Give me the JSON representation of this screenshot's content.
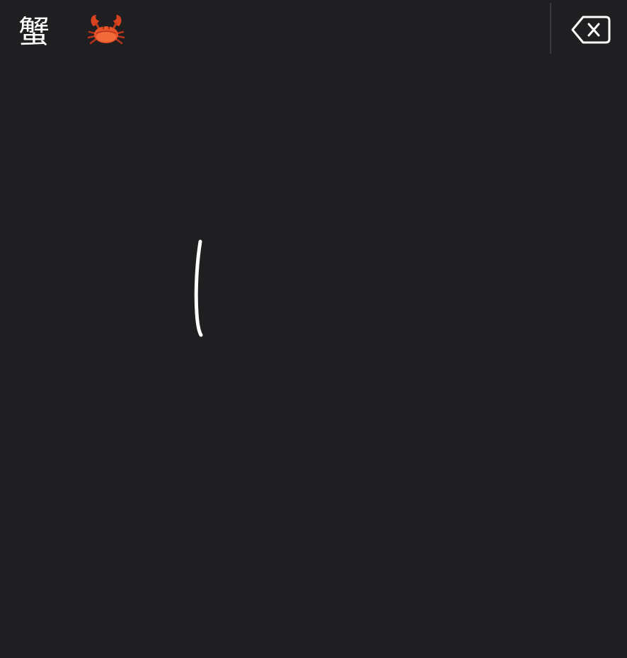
{
  "candidates": [
    {
      "label": "蟹",
      "kind": "kanji"
    },
    {
      "label": "crab",
      "kind": "emoji",
      "icon": "crab-emoji-icon"
    }
  ],
  "delete_key": {
    "icon": "delete-backspace-icon"
  },
  "colors": {
    "background": "#1f1f21",
    "ink": "#ffffff",
    "divider": "#3a3a3d",
    "crab_body": "#e8542a",
    "crab_shadow": "#b8331a"
  },
  "handwriting": {
    "icon": "ink-stroke"
  }
}
